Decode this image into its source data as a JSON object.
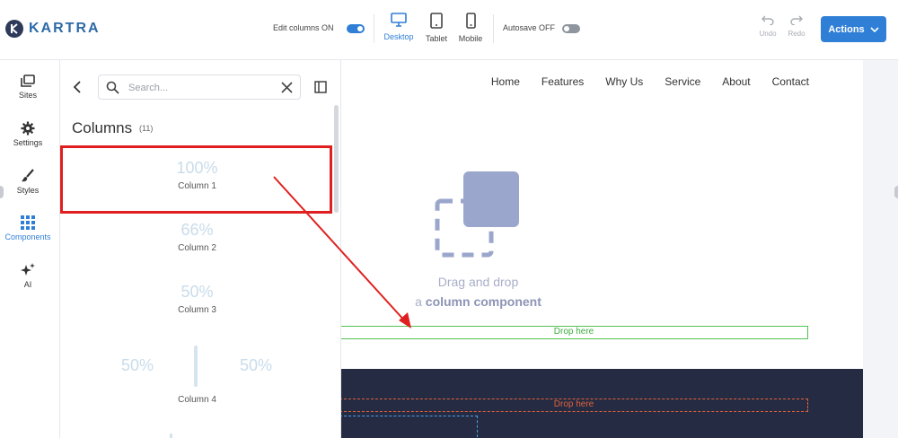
{
  "brand": {
    "name": "KARTRA"
  },
  "toolbar": {
    "edit_columns_label": "Edit columns ON",
    "devices": [
      {
        "label": "Desktop",
        "icon": "desktop-icon",
        "active": true
      },
      {
        "label": "Tablet",
        "icon": "tablet-icon",
        "active": false
      },
      {
        "label": "Mobile",
        "icon": "mobile-icon",
        "active": false
      }
    ],
    "autosave_label": "Autosave OFF",
    "undo_label": "Undo",
    "redo_label": "Redo",
    "actions_label": "Actions"
  },
  "rail": {
    "items": [
      {
        "label": "Sites",
        "icon": "sites-icon"
      },
      {
        "label": "Settings",
        "icon": "gear-icon"
      },
      {
        "label": "Styles",
        "icon": "brush-icon"
      },
      {
        "label": "Components",
        "icon": "grid-icon",
        "active": true
      },
      {
        "label": "AI",
        "icon": "sparkle-icon"
      }
    ]
  },
  "panel": {
    "search_placeholder": "Search...",
    "title": "Columns",
    "count": "(11)",
    "columns": [
      {
        "pct": "100%",
        "name": "Column 1"
      },
      {
        "pct": "66%",
        "name": "Column 2"
      },
      {
        "pct": "50%",
        "name": "Column 3"
      }
    ],
    "column4": {
      "left_pct": "50%",
      "right_pct": "50%",
      "name": "Column 4"
    }
  },
  "canvas": {
    "nav": [
      "Home",
      "Features",
      "Why Us",
      "Service",
      "About",
      "Contact"
    ],
    "drag_line1": "Drag and drop",
    "drag_line2_prefix": "a ",
    "drag_line2_bold": "column component",
    "drop_here_green": "Drop here",
    "drop_here_orange": "Drop here"
  },
  "colors": {
    "accent": "#2f7fd6",
    "highlight_red": "#e02020",
    "drop_green": "#53c253",
    "drop_orange": "#e0613a",
    "dark_section": "#252b42"
  }
}
